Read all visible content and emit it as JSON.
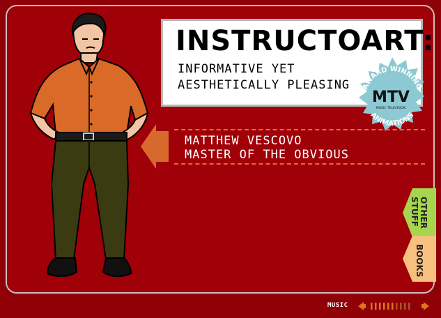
{
  "title": "INSTRUCTOART:",
  "subtitle": [
    "INFORMATIVE YET",
    "AESTHETICALLY PLEASING"
  ],
  "badge": {
    "top_text": "AWARD WINNING",
    "bottom_text": "ANIMATIONS",
    "logo_text": "MTV",
    "logo_sub": "MUSIC TELEVISION"
  },
  "name": [
    "MATTHEW VESCOVO",
    "MASTER OF THE OBVIOUS"
  ],
  "tabs": {
    "other": "OTHER STUFF",
    "books": "BOOKS"
  },
  "music": {
    "label": "MUSIC",
    "level_fraction": 0.6
  },
  "colors": {
    "background": "#a00008",
    "accent": "#d8692c",
    "tab_green": "#a6d650",
    "tab_peach": "#f7c07e",
    "badge": "#8cc9d3"
  },
  "icons": [
    "arrow-left-icon",
    "music-prev-icon",
    "music-next-icon",
    "mtv-logo-icon"
  ]
}
